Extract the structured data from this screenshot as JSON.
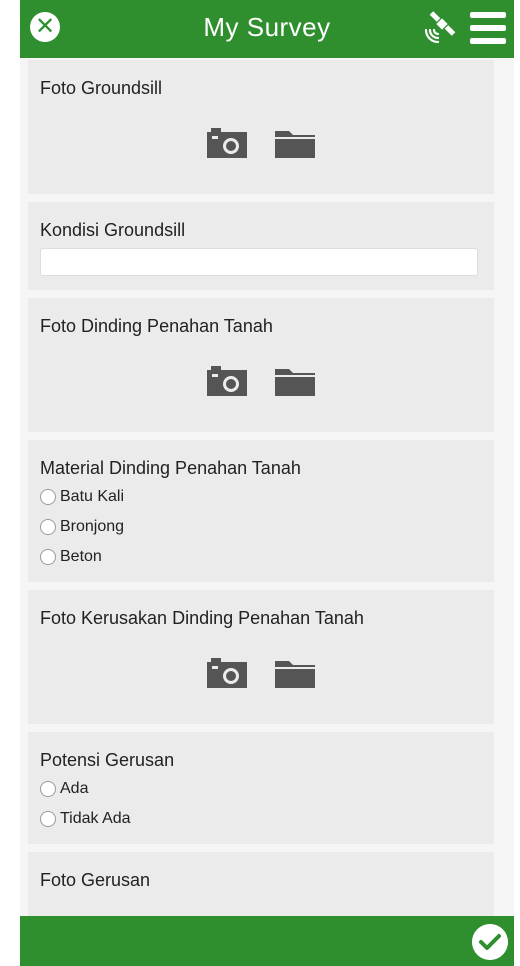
{
  "header": {
    "title": "My Survey",
    "close_icon": "close-icon",
    "gps_icon": "satellite-icon",
    "menu_icon": "hamburger-menu-icon"
  },
  "form": {
    "foto_groundsill": {
      "label": "Foto Groundsill"
    },
    "kondisi_groundsill": {
      "label": "Kondisi Groundsill",
      "value": ""
    },
    "foto_dinding": {
      "label": "Foto Dinding Penahan Tanah"
    },
    "material_dinding": {
      "label": "Material Dinding Penahan Tanah",
      "options": [
        "Batu Kali",
        "Bronjong",
        "Beton"
      ]
    },
    "foto_kerusakan": {
      "label": "Foto Kerusakan Dinding Penahan Tanah"
    },
    "potensi_gerusan": {
      "label": "Potensi Gerusan",
      "options": [
        "Ada",
        "Tidak Ada"
      ]
    },
    "foto_gerusan": {
      "label": "Foto Gerusan"
    }
  },
  "footer": {
    "submit_icon": "checkmark-icon"
  },
  "colors": {
    "accent": "#2f8f2f",
    "card": "#ebebeb",
    "icon": "#555555"
  }
}
